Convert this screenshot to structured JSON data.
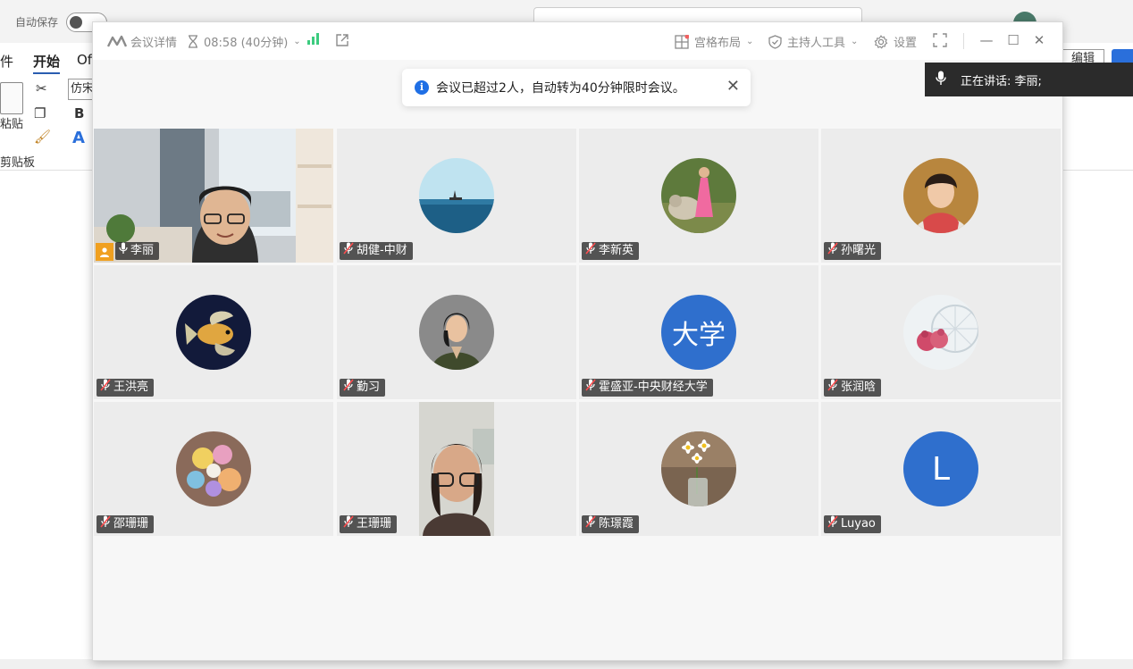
{
  "background_app": {
    "autosave_label": "自动保存",
    "tabs": [
      {
        "label": "件"
      },
      {
        "label": "开始"
      },
      {
        "label": "Of"
      }
    ],
    "paste_label": "粘贴",
    "clipboard_label": "剪贴板",
    "font_value": "仿宋",
    "bold_label": "B",
    "text_effect_label": "A",
    "edit_button_label": "编辑"
  },
  "meeting": {
    "toolbar": {
      "details_label": "会议详情",
      "timer_text": "08:58 (40分钟)",
      "layout_label": "宫格布局",
      "host_tools_label": "主持人工具",
      "settings_label": "设置"
    },
    "notice": {
      "text": "会议已超过2人，自动转为40分钟限时会议。",
      "info_glyph": "i"
    },
    "speaking": {
      "label": "正在讲话:  李丽;"
    },
    "participants": [
      {
        "name": "李丽",
        "avatar": "self-video",
        "mic": "on",
        "host": true
      },
      {
        "name": "胡健-中财",
        "avatar": "sea-photo",
        "mic": "muted"
      },
      {
        "name": "李新英",
        "avatar": "girl-dog-photo",
        "mic": "muted"
      },
      {
        "name": "孙曙光",
        "avatar": "woman-portrait-photo",
        "mic": "muted"
      },
      {
        "name": "王洪亮",
        "avatar": "fish-photo",
        "mic": "muted"
      },
      {
        "name": "勤习",
        "avatar": "woman-blazer-photo",
        "mic": "muted"
      },
      {
        "name": "霍盛亚-中央财经大学",
        "avatar": "letters",
        "avatar_text": "大学",
        "mic": "muted"
      },
      {
        "name": "张润晗",
        "avatar": "teddy-photo",
        "mic": "muted"
      },
      {
        "name": "邵珊珊",
        "avatar": "toys-photo",
        "mic": "muted"
      },
      {
        "name": "王珊珊",
        "avatar": "video",
        "mic": "muted"
      },
      {
        "name": "陈璟霞",
        "avatar": "daisy-photo",
        "mic": "muted"
      },
      {
        "name": "Luyao",
        "avatar": "letters",
        "avatar_text": "L",
        "mic": "muted"
      }
    ],
    "colors": {
      "active_border": "#3ccb7f",
      "avatar_blue": "#2f6fcd",
      "info_blue": "#1f6fe5",
      "host_badge": "#f0a020"
    }
  }
}
